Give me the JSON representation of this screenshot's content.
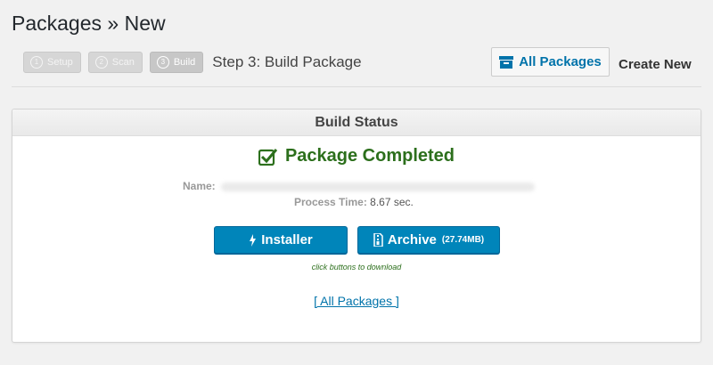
{
  "header": {
    "title": "Packages » New"
  },
  "steps": [
    {
      "num": "1",
      "label": "Setup"
    },
    {
      "num": "2",
      "label": "Scan"
    },
    {
      "num": "3",
      "label": "Build"
    }
  ],
  "step_title": "Step 3: Build Package",
  "toolbar": {
    "all_packages": "All Packages",
    "create_new": "Create New"
  },
  "panel": {
    "title": "Build Status",
    "status": "Package Completed",
    "name_label": "Name:",
    "process_time_label": "Process Time:",
    "process_time_value": "8.67 sec.",
    "installer_label": "Installer",
    "archive_label": "Archive",
    "archive_size": "(27.74MB)",
    "hint": "click buttons to download",
    "all_packages_link": "[ All Packages ]"
  },
  "colors": {
    "accent": "#0085ba",
    "success": "#2c6f1c",
    "link": "#0073aa"
  },
  "icons": [
    "box-icon",
    "check-square-icon",
    "bolt-icon",
    "zip-file-icon"
  ]
}
